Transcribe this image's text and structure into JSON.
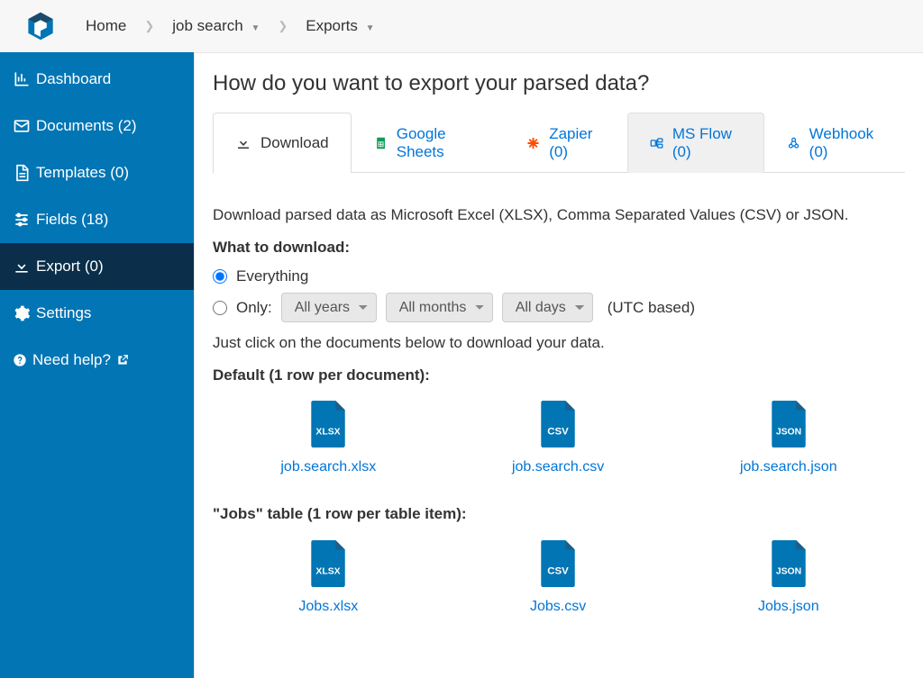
{
  "breadcrumbs": {
    "home": "Home",
    "job_search": "job search",
    "exports": "Exports"
  },
  "sidebar": {
    "dashboard": "Dashboard",
    "documents": "Documents (2)",
    "templates": "Templates (0)",
    "fields": "Fields (18)",
    "export": "Export (0)",
    "settings": "Settings",
    "help": "Need help?"
  },
  "page": {
    "title": "How do you want to export your parsed data?"
  },
  "tabs": {
    "download": "Download",
    "sheets": "Google Sheets",
    "zapier": "Zapier (0)",
    "msflow": "MS Flow (0)",
    "webhook": "Webhook (0)"
  },
  "download_section": {
    "intro": "Download parsed data as Microsoft Excel (XLSX), Comma Separated Values (CSV) or JSON.",
    "what_to_download": "What to download:",
    "everything": "Everything",
    "only": "Only:",
    "all_years": "All years",
    "all_months": "All months",
    "all_days": "All days",
    "utc": "(UTC based)",
    "click_hint": "Just click on the documents below to download your data.",
    "default_heading": "Default (1 row per document):",
    "jobs_heading": "\"Jobs\" table (1 row per table item):",
    "files_default": {
      "xlsx": "job.search.xlsx",
      "csv": "job.search.csv",
      "json": "job.search.json"
    },
    "files_jobs": {
      "xlsx": "Jobs.xlsx",
      "csv": "Jobs.csv",
      "json": "Jobs.json"
    }
  }
}
